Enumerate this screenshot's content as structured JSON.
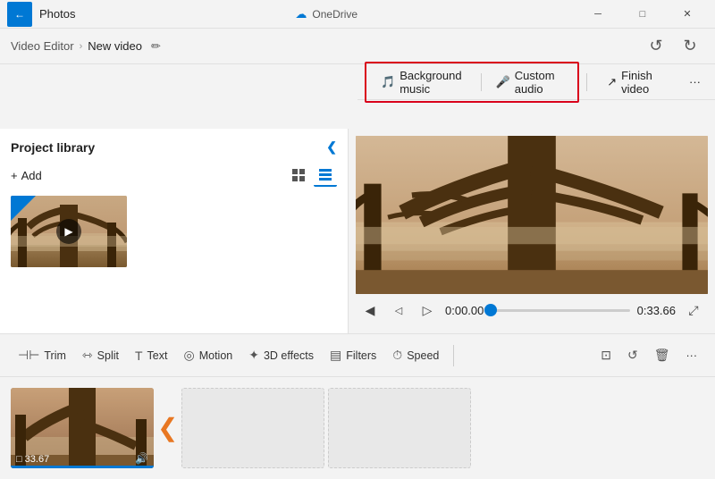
{
  "titlebar": {
    "app_name": "Photos",
    "ondrive_label": "OneDrive",
    "minimize": "─",
    "maximize": "□",
    "close": "✕"
  },
  "breadcrumb": {
    "parent": "Video Editor",
    "separator": "›",
    "current": "New video",
    "edit_icon": "✏"
  },
  "audio_toolbar": {
    "background_music": "Background music",
    "custom_audio": "Custom audio",
    "finish_video": "Finish video",
    "more": "···"
  },
  "project_library": {
    "title": "Project library",
    "add_label": "+ Add",
    "grid_view": "⊞",
    "list_view": "☰",
    "collapse": "❮"
  },
  "preview": {
    "rewind": "◀",
    "prev_frame": "◁",
    "play": "▷",
    "time_current": "0:00.00",
    "time_total": "0:33.66",
    "expand": "⤢"
  },
  "edit_toolbar": {
    "trim": "Trim",
    "split": "Split",
    "text": "Text",
    "motion": "Motion",
    "effects_3d": "3D effects",
    "filters": "Filters",
    "speed": "Speed",
    "crop": "⊡",
    "rotate": "↺",
    "delete": "🗑",
    "more": "···"
  },
  "timeline": {
    "clip_duration": "33.67",
    "clip_monitor": "□",
    "clip_audio": "🔊"
  }
}
